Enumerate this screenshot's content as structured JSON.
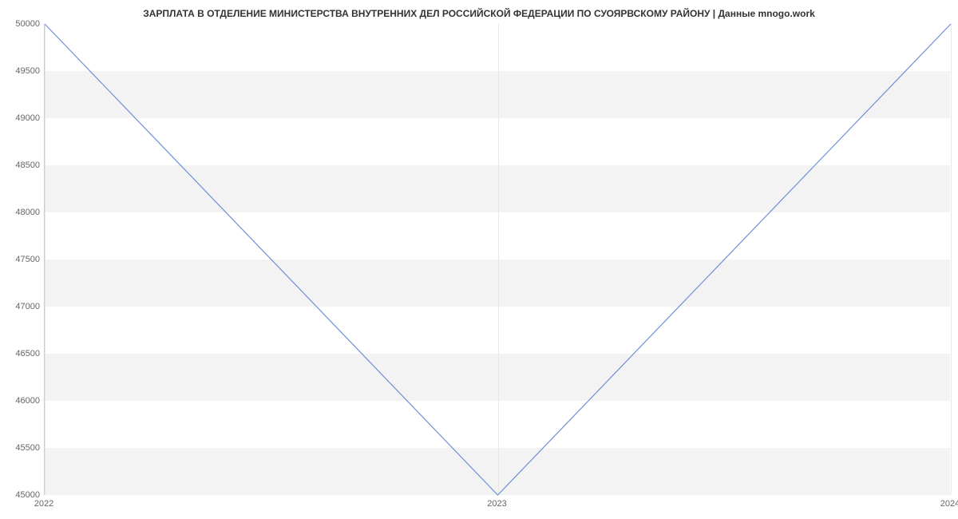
{
  "chart_data": {
    "type": "line",
    "title": "ЗАРПЛАТА В ОТДЕЛЕНИЕ МИНИСТЕРСТВА ВНУТРЕННИХ ДЕЛ РОССИЙСКОЙ ФЕДЕРАЦИИ ПО СУОЯРВСКОМУ РАЙОНУ | Данные mnogo.work",
    "x": [
      2022,
      2023,
      2024
    ],
    "values": [
      50000,
      45000,
      50000
    ],
    "xlabel": "",
    "ylabel": "",
    "ylim": [
      45000,
      50000
    ],
    "xlim": [
      2022,
      2024
    ],
    "y_ticks": [
      45000,
      45500,
      46000,
      46500,
      47000,
      47500,
      48000,
      48500,
      49000,
      49500,
      50000
    ],
    "x_ticks": [
      2022,
      2023,
      2024
    ],
    "line_color": "#6f8fd9"
  }
}
